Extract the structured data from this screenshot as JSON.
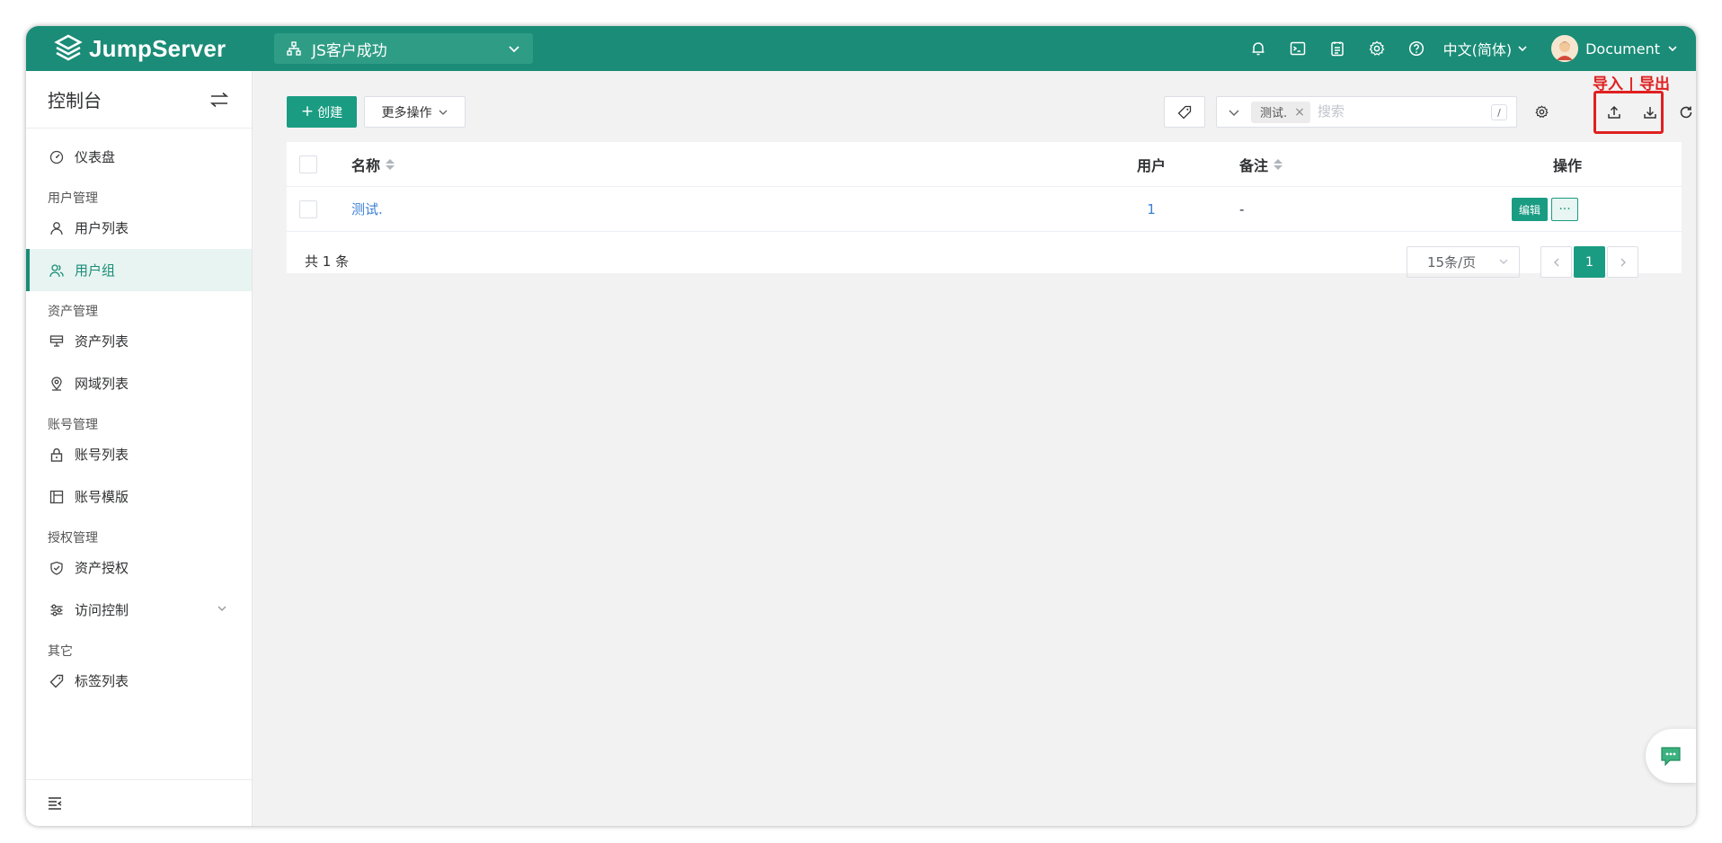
{
  "app": {
    "name": "JumpServer"
  },
  "header": {
    "org_selector": "JS客户成功",
    "language": "中文(简体)",
    "user": "Document",
    "icons": [
      "bell-icon",
      "terminal-icon",
      "clipboard-icon",
      "gear-icon",
      "help-icon"
    ]
  },
  "sidebar": {
    "title": "控制台",
    "dashboard": "仪表盘",
    "groups": {
      "user_mgmt": "用户管理",
      "asset_mgmt": "资产管理",
      "account_mgmt": "账号管理",
      "perm_mgmt": "授权管理",
      "other": "其它"
    },
    "items": {
      "user_list": "用户列表",
      "user_group": "用户组",
      "asset_list": "资产列表",
      "zone_list": "网域列表",
      "account_list": "账号列表",
      "account_template": "账号模版",
      "asset_perm": "资产授权",
      "access_control": "访问控制",
      "label_list": "标签列表"
    },
    "active": "user_group"
  },
  "toolbar": {
    "create": "创建",
    "more_actions": "更多操作",
    "filter_chip": "测试.",
    "search_placeholder": "搜索",
    "search_shortcut": "/",
    "annotation": "导入 | 导出"
  },
  "table": {
    "columns": {
      "name": "名称",
      "users": "用户",
      "note": "备注",
      "actions": "操作"
    },
    "rows": [
      {
        "name": "测试.",
        "users": "1",
        "note": "-",
        "edit": "编辑",
        "more": "···"
      }
    ],
    "total": "共 1 条",
    "page_size": "15条/页",
    "current_page": "1"
  },
  "colors": {
    "brand": "#1a8c77",
    "primary": "#1a9c82",
    "annotation": "#e02020",
    "link": "#3c7fd8"
  }
}
